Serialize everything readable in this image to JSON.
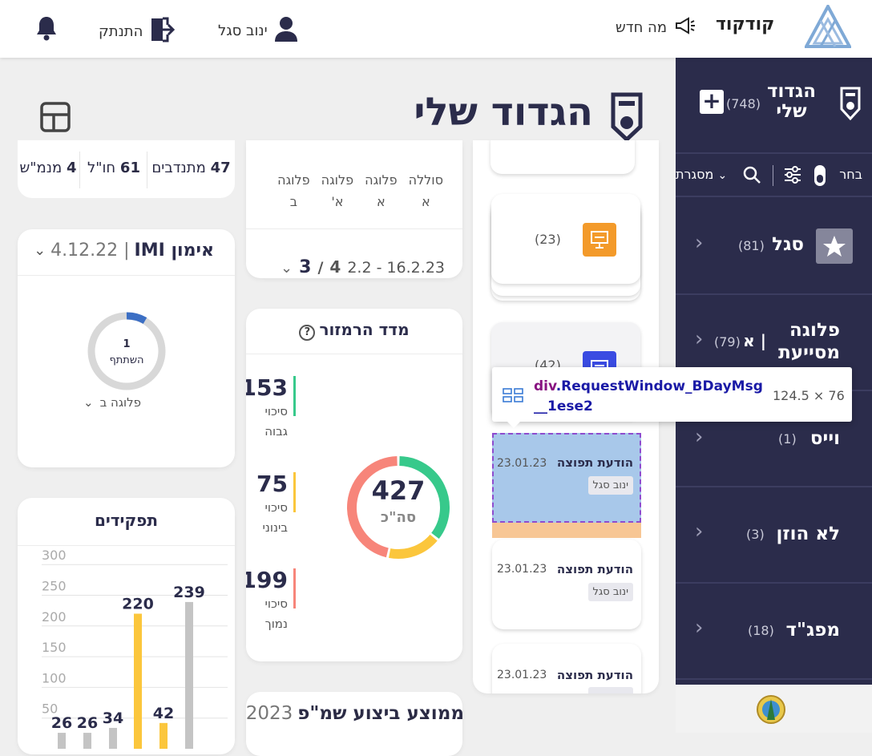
{
  "topbar": {
    "whats_new": "מה חדש",
    "brand": "קודקוד",
    "user": "ינוב סגל",
    "logout": "התנתק"
  },
  "page": {
    "title": "הגדוד שלי"
  },
  "sidebar": {
    "title_line1": "הגדוד",
    "title_line2": "שלי",
    "count": "(748)",
    "tools": {
      "select": "בחר",
      "frame": "מסגרת"
    },
    "items": [
      {
        "label": "סגל",
        "count": "(81)"
      },
      {
        "label_line1": "פלוגה",
        "label_line2": "מסייעת",
        "label_suffix": "| א",
        "count": "(79)"
      },
      {
        "label": "וייס",
        "count": "(1)"
      },
      {
        "label": "לא הוזן",
        "count": "(3)"
      },
      {
        "label": "מפג\"ד",
        "count": "(18)"
      }
    ]
  },
  "stats": {
    "volunteers_num": "47",
    "volunteers": "מתנדבים",
    "abroad_num": "61",
    "abroad": "חו\"ל",
    "leave_num": "4",
    "leave": "מנמ\"ש"
  },
  "training": {
    "title": "אימון IMI",
    "date": "| 4.12.22",
    "ring_num": "1",
    "ring_label": "השתתף",
    "company": "פלוגה ב"
  },
  "companies": {
    "cols": [
      {
        "l1": "סוללה",
        "l2": "א"
      },
      {
        "l1": "פלוגה",
        "l2": "א"
      },
      {
        "l1": "פלוגה",
        "l2": "א'"
      },
      {
        "l1": "פלוגה",
        "l2": "ב"
      }
    ],
    "range": "16.2.23 - 2.2",
    "pager_cur": "3",
    "pager_sep": "/",
    "pager_total": "4"
  },
  "index": {
    "title": "מדד הרמזור",
    "total": "427",
    "total_label": "סה\"כ",
    "rows": [
      {
        "value": "153",
        "l1": "סיכוי",
        "l2": "גבוה",
        "color": "#37c98b"
      },
      {
        "value": "75",
        "l1": "סיכוי",
        "l2": "בינוני",
        "color": "#fbc63c"
      },
      {
        "value": "199",
        "l1": "סיכוי",
        "l2": "נמוך",
        "color": "#f7857a"
      }
    ]
  },
  "roles": {
    "title": "תפקידים",
    "yticks": [
      "300",
      "250",
      "200",
      "150",
      "100",
      "50"
    ],
    "labels": [
      "239",
      "220",
      "42",
      "34",
      "26",
      "26"
    ]
  },
  "chart_data": {
    "type": "bar",
    "title": "תפקידים",
    "yticks": [
      300,
      250,
      200,
      150,
      100,
      50
    ],
    "values": [
      239,
      220,
      42,
      34,
      26,
      26
    ],
    "colors": [
      "#c4c4c4",
      "#fbc63c",
      "#fbc63c",
      "#c4c4c4",
      "#c4c4c4",
      "#c4c4c4"
    ]
  },
  "perf": {
    "title": "ממוצע ביצוע שמ\"פ",
    "year": "2023 |"
  },
  "requests": {
    "count_a": "(23)",
    "count_b": "(42)",
    "messages": [
      {
        "title": "הודעת תפוצה",
        "date": "23.01.23",
        "author": "ינוב סגל"
      },
      {
        "title": "הודעת תפוצה",
        "date": "23.01.23",
        "author": "ינוב סגל"
      },
      {
        "title": "הודעת תפוצה",
        "date": "23.01.23",
        "author": ""
      }
    ]
  },
  "tooltip": {
    "tag": "div",
    "cls": ".RequestWindow_BDayMsg",
    "cls2": "__1ese2",
    "size": "124.5 × 76"
  }
}
